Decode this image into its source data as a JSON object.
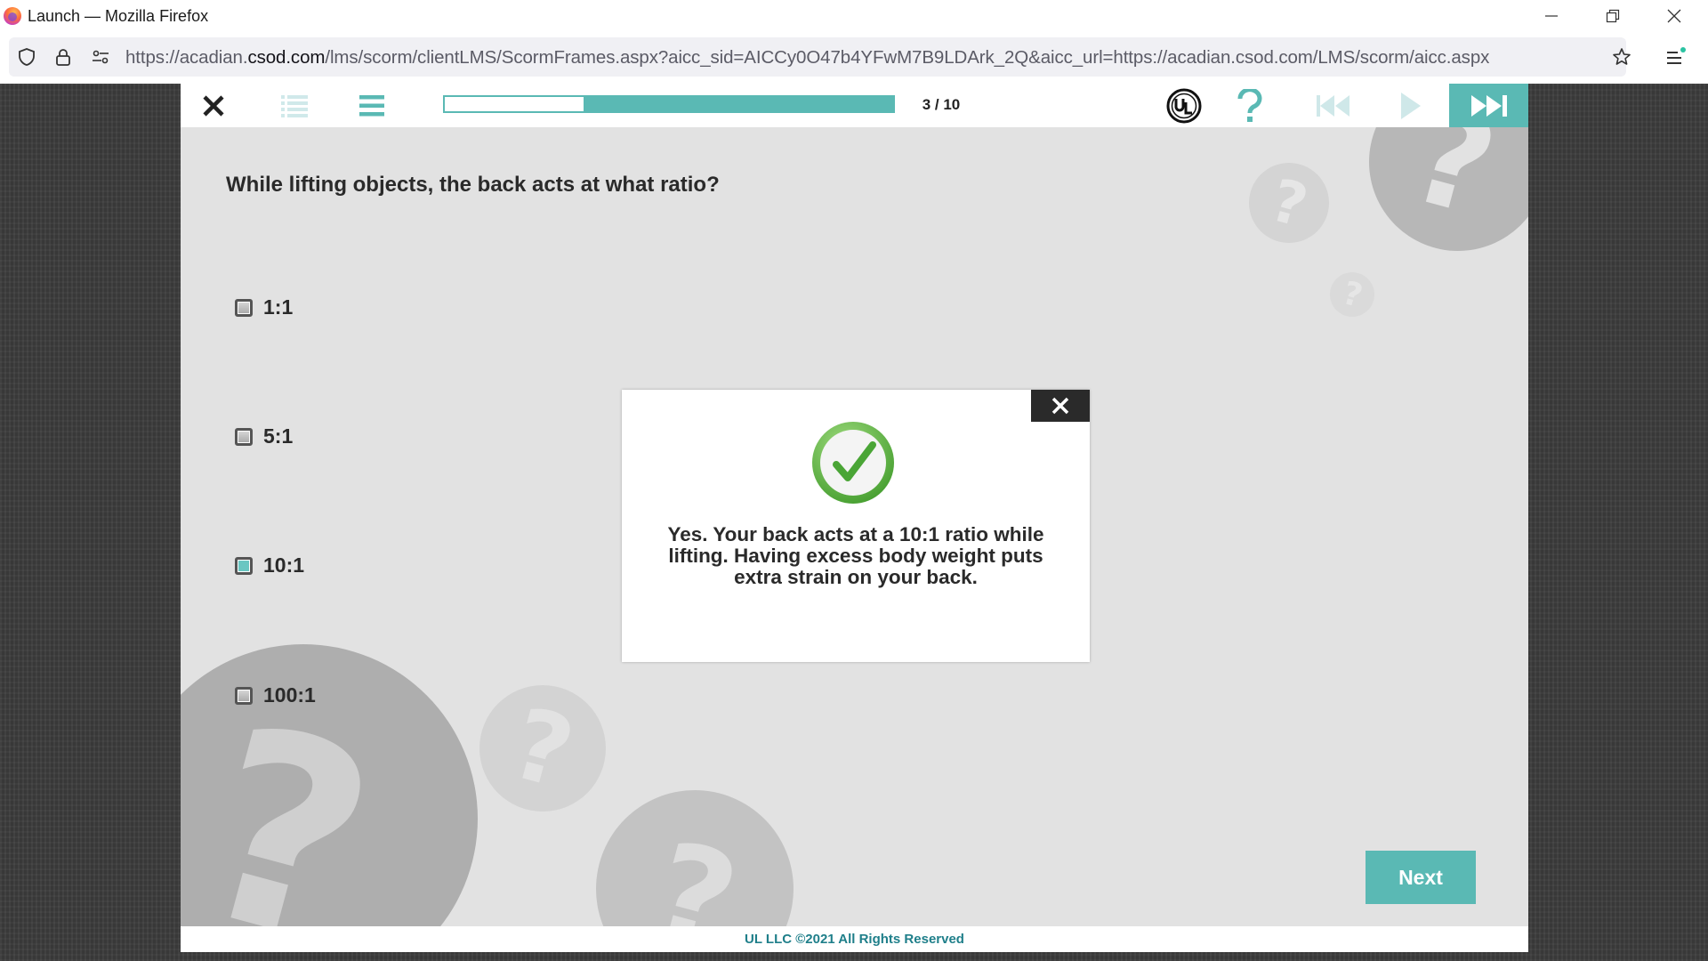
{
  "browser": {
    "window_title": "Launch — Mozilla Firefox",
    "url_prefix": "https://acadian.",
    "url_domain": "csod.com",
    "url_suffix": "/lms/scorm/clientLMS/ScormFrames.aspx?aicc_sid=AICCy0O47b4YFwM7B9LDArk_2Q&aicc_url=https://acadian.csod.com/LMS/scorm/aicc.aspx"
  },
  "toolbar": {
    "page_count": "3 / 10",
    "progress_fraction": 0.31,
    "accent_color": "#5ab9b4"
  },
  "question": {
    "text": "While lifting objects, the back acts at what ratio?",
    "options": [
      {
        "label": "1:1",
        "checked": false
      },
      {
        "label": "5:1",
        "checked": false
      },
      {
        "label": "10:1",
        "checked": true
      },
      {
        "label": "100:1",
        "checked": false
      }
    ]
  },
  "feedback": {
    "text": "Yes. Your back acts at a 10:1 ratio while lifting. Having excess body weight puts extra strain on your back."
  },
  "next_label": "Next",
  "footer": "UL LLC ©2021 All Rights Reserved",
  "icons": {
    "close": "close-icon",
    "menu": "menu-icon",
    "outline": "outline-icon",
    "ul_logo": "ul-logo-icon",
    "help": "help-icon",
    "rewind": "rewind-icon",
    "play": "play-icon",
    "fast_forward": "fast-forward-icon"
  }
}
